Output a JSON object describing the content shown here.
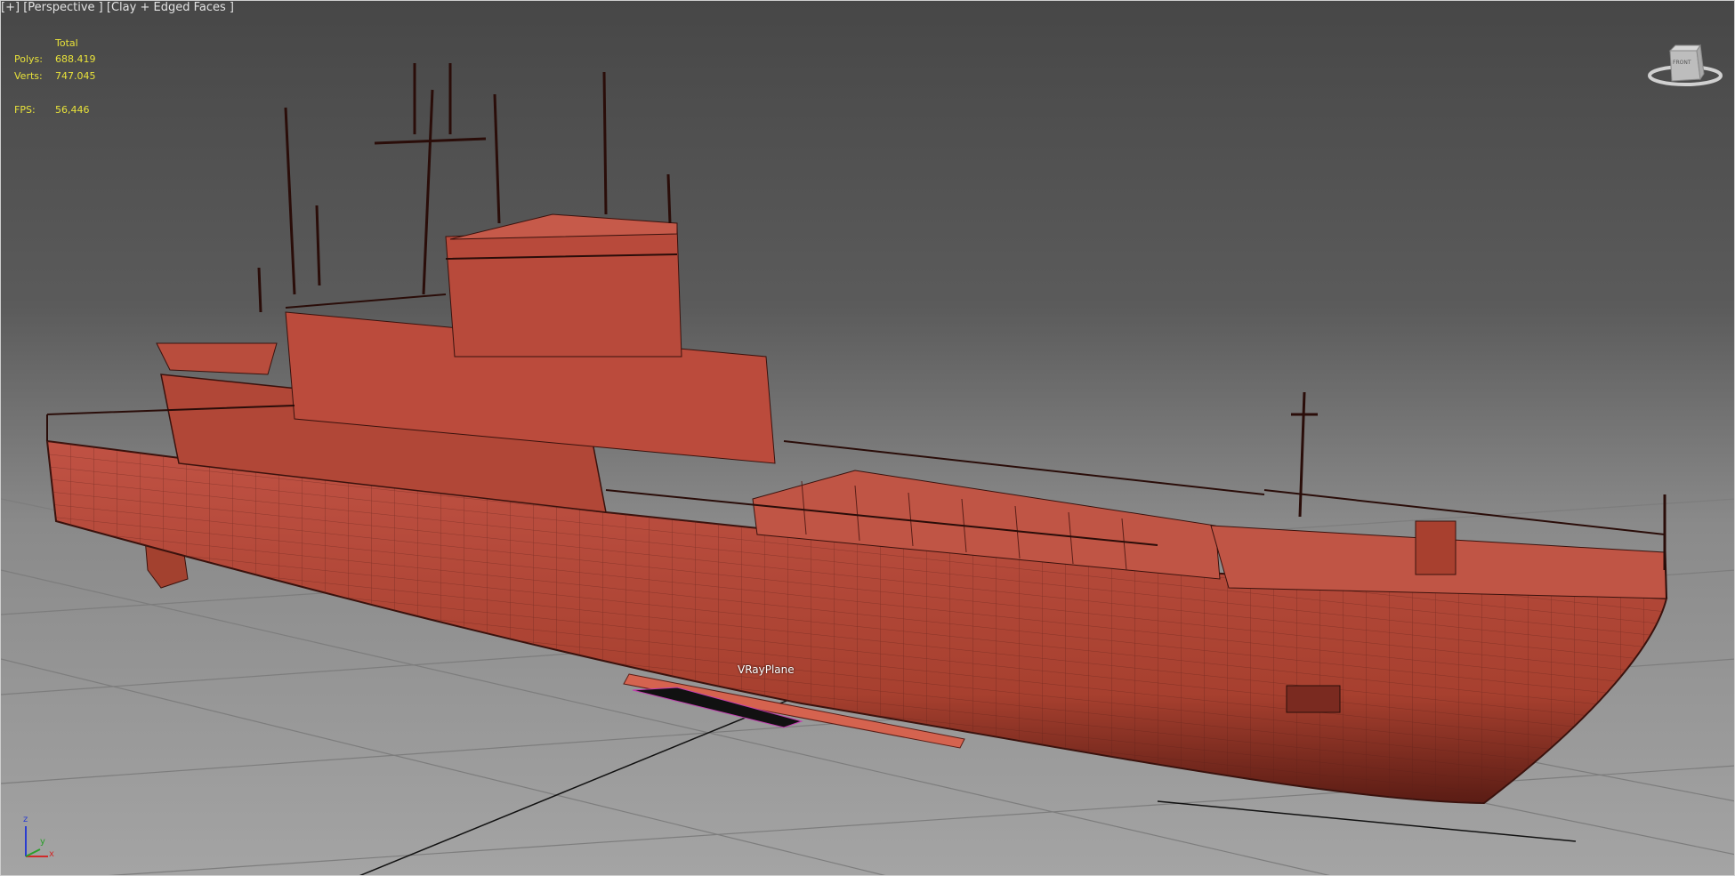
{
  "viewport": {
    "menu_plus": "[+]",
    "view_name": "[Perspective ]",
    "shading_mode": "[Clay + Edged Faces ]"
  },
  "stats": {
    "header": "Total",
    "polys_label": "Polys:",
    "polys_value": "688.419",
    "verts_label": "Verts:",
    "verts_value": "747.045",
    "fps_label": "FPS:",
    "fps_value": "56,446"
  },
  "scene": {
    "object_label": "VRayPlane",
    "clay_color": "#b4473b"
  },
  "viewcube": {
    "face_label": "FRONT"
  },
  "axis_tripod": {
    "x": "x",
    "y": "y",
    "z": "z"
  }
}
